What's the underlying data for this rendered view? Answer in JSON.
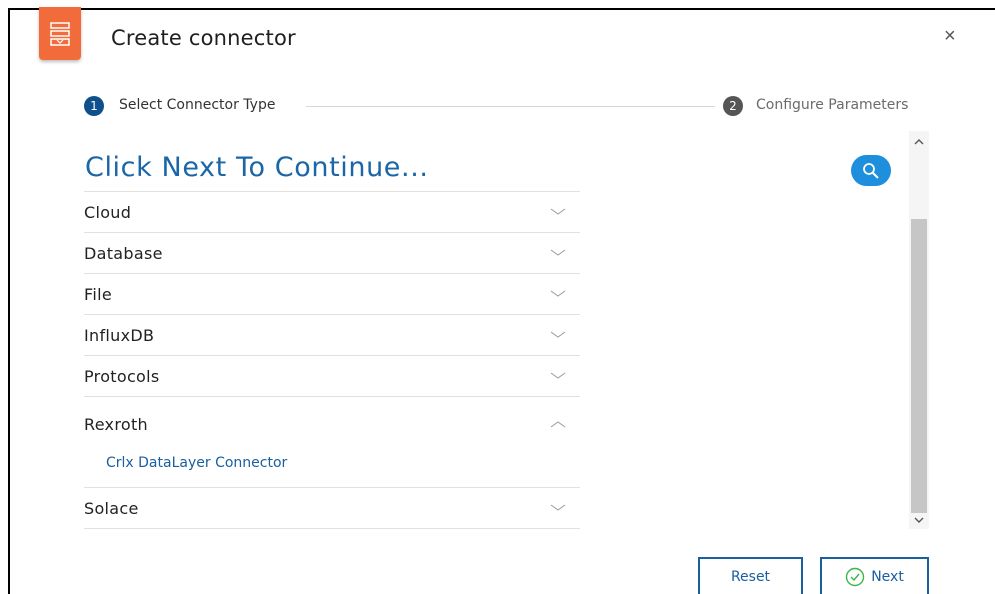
{
  "dialog": {
    "title": "Create connector",
    "close_symbol": "×",
    "header_icon": "server-connector-icon",
    "accent_color": "#f26b3a"
  },
  "stepper": {
    "steps": [
      {
        "number": "1",
        "label": "Select Connector Type",
        "state": "active"
      },
      {
        "number": "2",
        "label": "Configure Parameters",
        "state": "inactive"
      }
    ]
  },
  "main": {
    "heading": "Click Next To Continue...",
    "search_icon": "search-icon",
    "categories": [
      {
        "label": "Cloud",
        "expanded": false
      },
      {
        "label": "Database",
        "expanded": false
      },
      {
        "label": "File",
        "expanded": false
      },
      {
        "label": "InfluxDB",
        "expanded": false
      },
      {
        "label": "Protocols",
        "expanded": false
      },
      {
        "label": "Rexroth",
        "expanded": true,
        "items": [
          "Crlx DataLayer Connector"
        ]
      },
      {
        "label": "Solace",
        "expanded": false
      }
    ]
  },
  "footer": {
    "reset_label": "Reset",
    "next_label": "Next"
  },
  "colors": {
    "primary_blue": "#1a5fa0",
    "step_active": "#0e4f8c",
    "search_button": "#1e8fdc"
  }
}
